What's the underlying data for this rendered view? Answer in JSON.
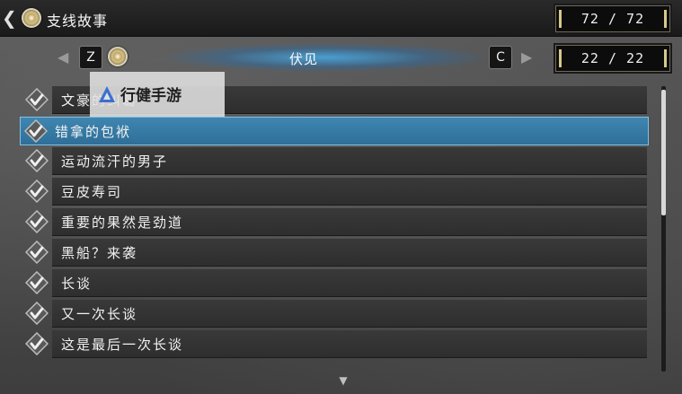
{
  "header": {
    "title": "支线故事",
    "total_count": "72 / 72"
  },
  "category": {
    "prev_key": "Z",
    "next_key": "C",
    "label": "伏见",
    "count": "22 / 22"
  },
  "quests": [
    {
      "label": "文豪的纠葛",
      "done": true,
      "selected": false
    },
    {
      "label": "错拿的包袱",
      "done": true,
      "selected": true
    },
    {
      "label": "运动流汗的男子",
      "done": true,
      "selected": false
    },
    {
      "label": "豆皮寿司",
      "done": true,
      "selected": false
    },
    {
      "label": "重要的果然是劲道",
      "done": true,
      "selected": false
    },
    {
      "label": "黑船？来袭",
      "done": true,
      "selected": false
    },
    {
      "label": "长谈",
      "done": true,
      "selected": false
    },
    {
      "label": "又一次长谈",
      "done": true,
      "selected": false
    },
    {
      "label": "这是最后一次长谈",
      "done": true,
      "selected": false
    }
  ],
  "watermark": {
    "text": "行健手游"
  },
  "icons": {
    "back": "chevron-left-icon",
    "emblem": "emblem-icon",
    "check": "checkmark-icon",
    "scroll_down": "chevron-down-icon"
  },
  "colors": {
    "selected_row": "#3f86b0",
    "row": "#393939",
    "category_glow": "#46aae6"
  }
}
